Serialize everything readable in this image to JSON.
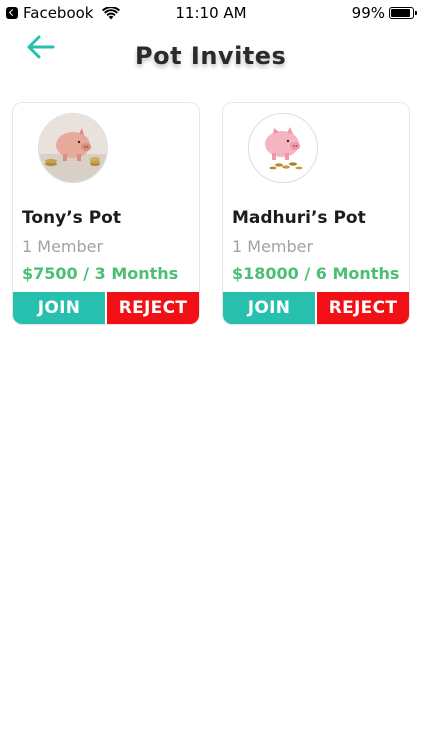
{
  "status_bar": {
    "app_name": "Facebook",
    "time": "11:10 AM",
    "battery": "99%"
  },
  "header": {
    "title": "Pot Invites",
    "accent_color": "#27bfae"
  },
  "invites": [
    {
      "name": "Tony’s Pot",
      "members": "1 Member",
      "amount": "$7500 / 3 Months",
      "join_label": "JOIN",
      "reject_label": "REJECT"
    },
    {
      "name": "Madhuri’s Pot",
      "members": "1 Member",
      "amount": "$18000 / 6 Months",
      "join_label": "JOIN",
      "reject_label": "REJECT"
    }
  ],
  "colors": {
    "join": "#27bfae",
    "reject": "#f30f16",
    "amount": "#4bbf73",
    "members": "#a3a3a3"
  }
}
